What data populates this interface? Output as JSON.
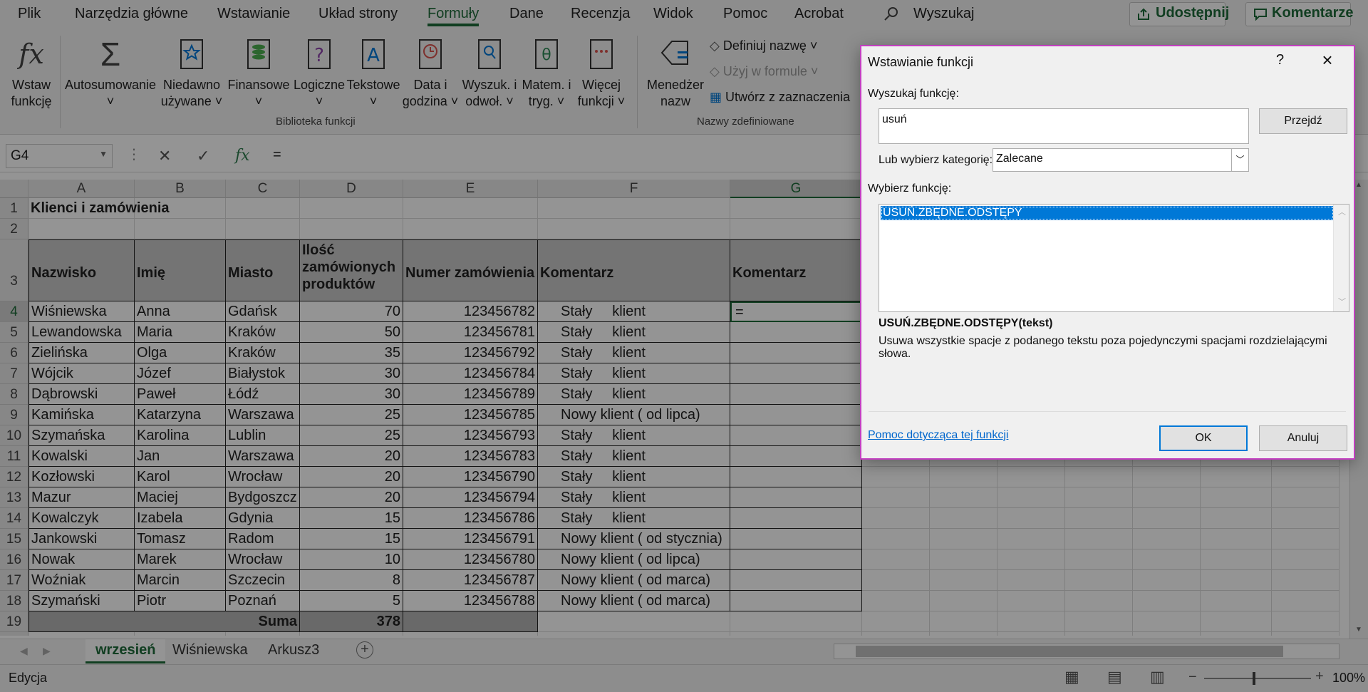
{
  "menu": {
    "tabs": [
      "Plik",
      "Narzędzia główne",
      "Wstawianie",
      "Układ strony",
      "Formuły",
      "Dane",
      "Recenzja",
      "Widok",
      "Pomoc",
      "Acrobat"
    ],
    "active_tab": "Formuły",
    "search_label": "Wyszukaj",
    "share_label": "Udostępnij",
    "comments_label": "Komentarze"
  },
  "ribbon": {
    "insert_fn": [
      "Wstaw",
      "funkcję"
    ],
    "autosum": [
      "Autosumowanie",
      "˅"
    ],
    "recent": [
      "Niedawno",
      "używane ˅"
    ],
    "financial": [
      "Finansowe",
      "˅"
    ],
    "logical": [
      "Logiczne",
      "˅"
    ],
    "text": [
      "Tekstowe",
      "˅"
    ],
    "datetime": [
      "Data i",
      "godzina ˅"
    ],
    "lookup": [
      "Wyszuk. i",
      "odwoł. ˅"
    ],
    "math": [
      "Matem. i",
      "tryg. ˅"
    ],
    "more": [
      "Więcej",
      "funkcji ˅"
    ],
    "name_manager": [
      "Menedżer",
      "nazw"
    ],
    "define_name": "Definiuj nazwę ˅",
    "use_in_formula": "Użyj w formule ˅",
    "create_from_sel": "Utwórz z zaznaczenia",
    "group_library": "Biblioteka funkcji",
    "group_names": "Nazwy zdefiniowane"
  },
  "formula_bar": {
    "name_box": "G4",
    "formula": "="
  },
  "columns": [
    "A",
    "B",
    "C",
    "D",
    "E",
    "F",
    "G"
  ],
  "sheet": {
    "title": "Klienci i zamówienia",
    "headers": [
      "Nazwisko",
      "Imię",
      "Miasto",
      "Ilość zamówionych produktów",
      "Numer zamówienia",
      "Komentarz",
      "Komentarz"
    ],
    "rows": [
      [
        "Wiśniewska",
        "Anna",
        "Gdańsk",
        "70",
        "123456782",
        "Stały     klient"
      ],
      [
        "Lewandowska",
        "Maria",
        "Kraków",
        "50",
        "123456781",
        "Stały     klient"
      ],
      [
        "Zielińska",
        "Olga",
        "Kraków",
        "35",
        "123456792",
        "Stały     klient"
      ],
      [
        "Wójcik",
        "Józef",
        "Białystok",
        "30",
        "123456784",
        "Stały     klient"
      ],
      [
        "Dąbrowski",
        "Paweł",
        "Łódź",
        "30",
        "123456789",
        "Stały     klient"
      ],
      [
        "Kamińska",
        "Katarzyna",
        "Warszawa",
        "25",
        "123456785",
        "Nowy klient ( od lipca)"
      ],
      [
        "Szymańska",
        "Karolina",
        "Lublin",
        "25",
        "123456793",
        "Stały     klient"
      ],
      [
        "Kowalski",
        "Jan",
        "Warszawa",
        "20",
        "123456783",
        "Stały     klient"
      ],
      [
        "Kozłowski",
        "Karol",
        "Wrocław",
        "20",
        "123456790",
        "Stały     klient"
      ],
      [
        "Mazur",
        "Maciej",
        "Bydgoszcz",
        "20",
        "123456794",
        "Stały     klient"
      ],
      [
        "Kowalczyk",
        "Izabela",
        "Gdynia",
        "15",
        "123456786",
        "Stały     klient"
      ],
      [
        "Jankowski",
        "Tomasz",
        "Radom",
        "15",
        "123456791",
        "Nowy klient ( od stycznia)"
      ],
      [
        "Nowak",
        "Marek",
        "Wrocław",
        "10",
        "123456780",
        "Nowy klient ( od lipca)"
      ],
      [
        "Woźniak",
        "Marcin",
        "Szczecin",
        "8",
        "123456787",
        "Nowy klient ( od marca)"
      ],
      [
        "Szymański",
        "Piotr",
        "Poznań",
        "5",
        "123456788",
        "Nowy klient ( od marca)"
      ]
    ],
    "sum_label": "Suma",
    "sum_value": "378",
    "active_cell_value": "="
  },
  "sheet_tabs": [
    "wrzesień",
    "Wiśniewska",
    "Arkusz3"
  ],
  "status": {
    "mode": "Edycja",
    "zoom": "100%"
  },
  "dialog": {
    "title": "Wstawianie funkcji",
    "help_glyph": "?",
    "search_label": "Wyszukaj funkcję:",
    "search_value": "usuń",
    "go_button": "Przejdź",
    "category_label": "Lub wybierz kategorię:",
    "category_value": "Zalecane",
    "select_label": "Wybierz funkcję:",
    "functions": [
      "USUŃ.ZBĘDNE.ODSTĘPY"
    ],
    "signature": "USUŃ.ZBĘDNE.ODSTĘPY(tekst)",
    "description": "Usuwa wszystkie spacje z podanego tekstu poza pojedynczymi spacjami rozdzielającymi słowa.",
    "help_link": "Pomoc dotycząca tej funkcji",
    "ok": "OK",
    "cancel": "Anuluj"
  }
}
